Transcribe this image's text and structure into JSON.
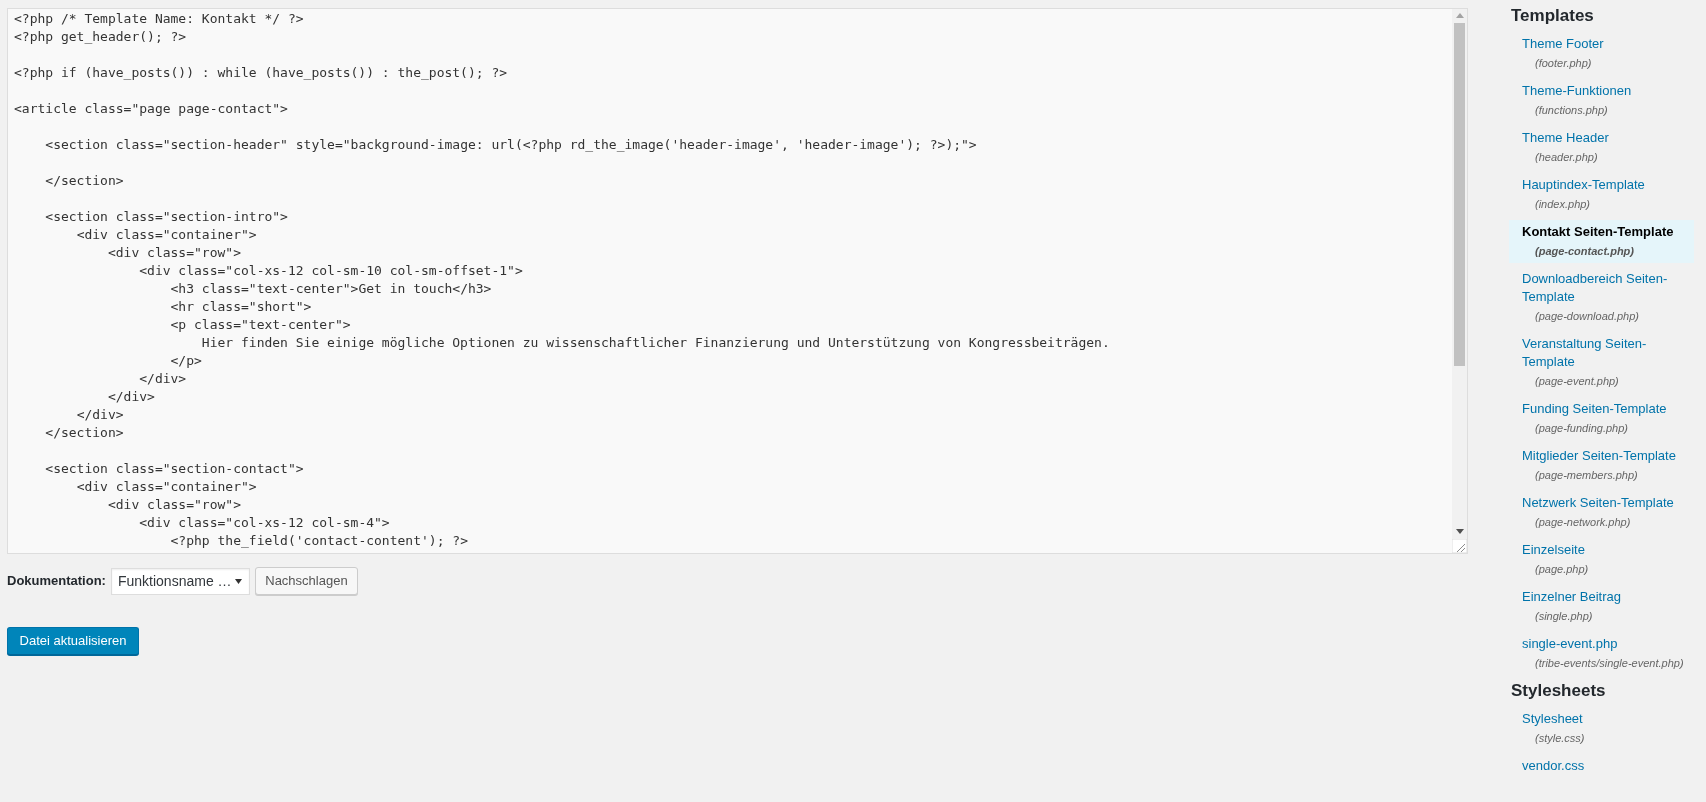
{
  "code_editor": {
    "value": "<?php /* Template Name: Kontakt */ ?>\n<?php get_header(); ?>\n\n<?php if (have_posts()) : while (have_posts()) : the_post(); ?>\n\n<article class=\"page page-contact\">\n\n    <section class=\"section-header\" style=\"background-image: url(<?php rd_the_image('header-image', 'header-image'); ?>);\">\n\n    </section>\n\n    <section class=\"section-intro\">\n        <div class=\"container\">\n            <div class=\"row\">\n                <div class=\"col-xs-12 col-sm-10 col-sm-offset-1\">\n                    <h3 class=\"text-center\">Get in touch</h3>\n                    <hr class=\"short\">\n                    <p class=\"text-center\">\n                        Hier finden Sie einige mögliche Optionen zu wissenschaftlicher Finanzierung und Unterstützung von Kongressbeiträgen.\n                    </p>\n                </div>\n            </div>\n        </div>\n    </section>\n\n    <section class=\"section-contact\">\n        <div class=\"container\">\n            <div class=\"row\">\n                <div class=\"col-xs-12 col-sm-4\">\n                    <?php the_field('contact-content'); ?>"
  },
  "documentation": {
    "label": "Dokumentation:",
    "select_value": "Funktionsname …",
    "lookup_button": "Nachschlagen"
  },
  "update_button": "Datei aktualisieren",
  "sidebar": {
    "sections": [
      {
        "title": "Templates",
        "items": [
          {
            "label": "Theme Footer",
            "file": "(footer.php)",
            "selected": false
          },
          {
            "label": "Theme-Funktionen",
            "file": "(functions.php)",
            "selected": false
          },
          {
            "label": "Theme Header",
            "file": "(header.php)",
            "selected": false
          },
          {
            "label": "Hauptindex-Template",
            "file": "(index.php)",
            "selected": false
          },
          {
            "label": "Kontakt Seiten-Template",
            "file": "(page-contact.php)",
            "selected": true
          },
          {
            "label": "Downloadbereich Seiten-Template",
            "file": "(page-download.php)",
            "selected": false
          },
          {
            "label": "Veranstaltung Seiten-Template",
            "file": "(page-event.php)",
            "selected": false
          },
          {
            "label": "Funding Seiten-Template",
            "file": "(page-funding.php)",
            "selected": false
          },
          {
            "label": "Mitglieder Seiten-Template",
            "file": "(page-members.php)",
            "selected": false
          },
          {
            "label": "Netzwerk Seiten-Template",
            "file": "(page-network.php)",
            "selected": false
          },
          {
            "label": "Einzelseite",
            "file": "(page.php)",
            "selected": false
          },
          {
            "label": "Einzelner Beitrag",
            "file": "(single.php)",
            "selected": false
          },
          {
            "label": "single-event.php",
            "file": "(tribe-events/single-event.php)",
            "selected": false
          }
        ]
      },
      {
        "title": "Stylesheets",
        "items": [
          {
            "label": "Stylesheet",
            "file": "(style.css)",
            "selected": false
          },
          {
            "label": "vendor.css",
            "selected": false
          }
        ]
      }
    ]
  }
}
